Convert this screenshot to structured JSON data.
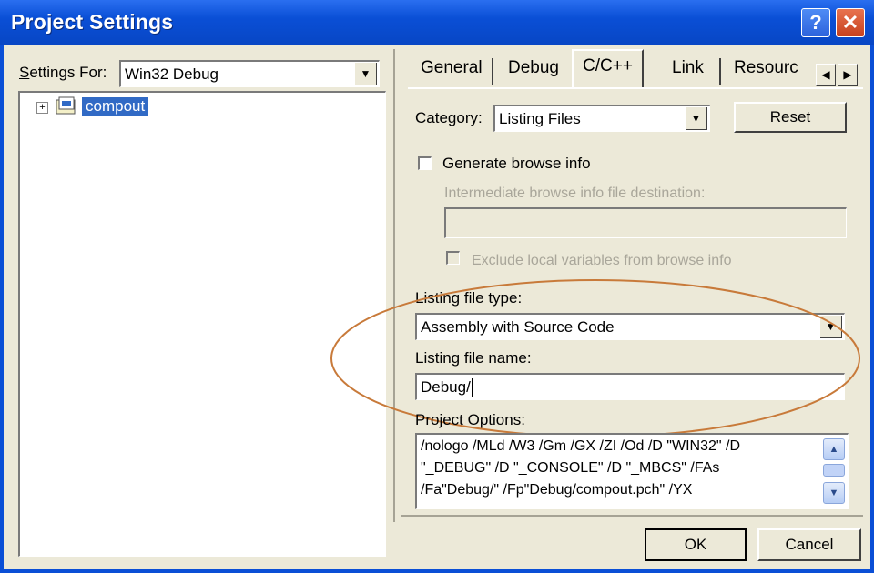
{
  "window": {
    "title": "Project Settings",
    "help_glyph": "?",
    "close_glyph": "✕"
  },
  "left": {
    "settings_for_label": "Settings For:",
    "settings_for_value": "Win32 Debug",
    "tree_expander": "+",
    "tree_item": "compout"
  },
  "tabs": [
    "General",
    "Debug",
    "C/C++",
    "Link",
    "Resourc"
  ],
  "active_tab_index": 2,
  "category": {
    "label": "Category:",
    "value": "Listing Files",
    "reset_label": "Reset"
  },
  "browse": {
    "generate_label": "Generate browse info",
    "generate_checked": false,
    "intermediate_label": "Intermediate browse info file destination:",
    "exclude_label": "Exclude local variables from browse info"
  },
  "listing": {
    "type_label": "Listing file type:",
    "type_value": "Assembly with Source Code",
    "name_label": "Listing file name:",
    "name_value": "Debug/"
  },
  "project_options": {
    "label": "Project Options:",
    "lines": [
      "/nologo /MLd /W3 /Gm /GX /ZI /Od /D \"WIN32\" /D",
      "\"_DEBUG\" /D \"_CONSOLE\" /D \"_MBCS\" /FAs",
      "/Fa\"Debug/\" /Fp\"Debug/compout.pch\" /YX"
    ]
  },
  "buttons": {
    "ok": "OK",
    "cancel": "Cancel"
  },
  "colors": {
    "titlebar": "#0a4fd6",
    "selection": "#316ac5",
    "annotation": "#c87a3a",
    "dialog_bg": "#ece9d8"
  },
  "icons": {
    "scroll_up": "▲",
    "scroll_down": "▼",
    "tab_left": "◀",
    "tab_right": "▶",
    "dropdown": "▼"
  }
}
